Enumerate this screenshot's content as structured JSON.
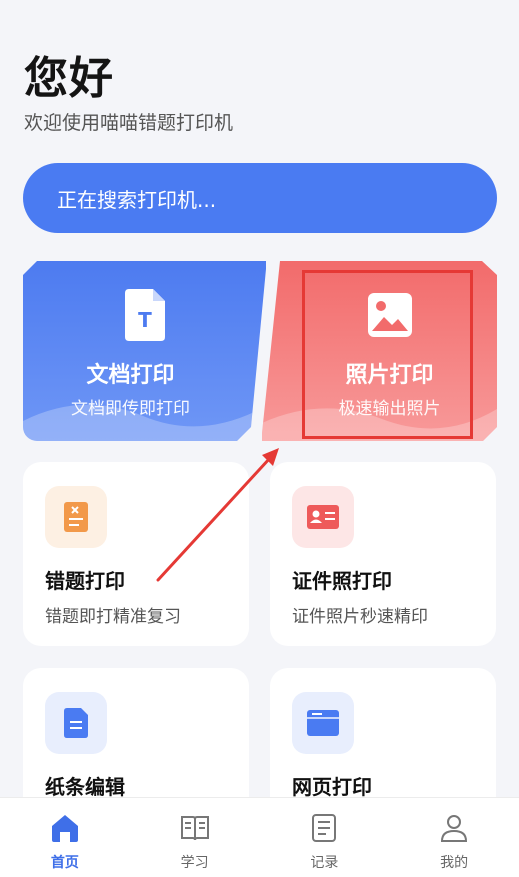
{
  "header": {
    "greeting": "您好",
    "subtitle": "欢迎使用喵喵错题打印机"
  },
  "search": {
    "status_text": "正在搜索打印机..."
  },
  "feature_cards": [
    {
      "title": "文档打印",
      "subtitle": "文档即传即打印",
      "icon": "document-icon",
      "color": "#4d7bf0"
    },
    {
      "title": "照片打印",
      "subtitle": "极速输出照片",
      "icon": "photo-icon",
      "color": "#f26b6b"
    }
  ],
  "tool_cards": [
    {
      "title": "错题打印",
      "subtitle": "错题即打精准复习",
      "icon": "mistake-sheet-icon",
      "color": "#f2994a"
    },
    {
      "title": "证件照打印",
      "subtitle": "证件照片秒速精印",
      "icon": "id-card-icon",
      "color": "#ee5a5a"
    },
    {
      "title": "纸条编辑",
      "subtitle": "",
      "icon": "note-icon",
      "color": "#4a7bf2"
    },
    {
      "title": "网页打印",
      "subtitle": "",
      "icon": "webpage-icon",
      "color": "#4a7bf2"
    }
  ],
  "nav": {
    "items": [
      {
        "label": "首页",
        "icon": "home-icon",
        "active": true
      },
      {
        "label": "学习",
        "icon": "book-icon",
        "active": false
      },
      {
        "label": "记录",
        "icon": "record-icon",
        "active": false
      },
      {
        "label": "我的",
        "icon": "user-icon",
        "active": false
      }
    ]
  },
  "colors": {
    "accent": "#4a7bf2",
    "photo": "#f26b6b",
    "annotation": "#e53935",
    "background": "#f4f5f9"
  }
}
